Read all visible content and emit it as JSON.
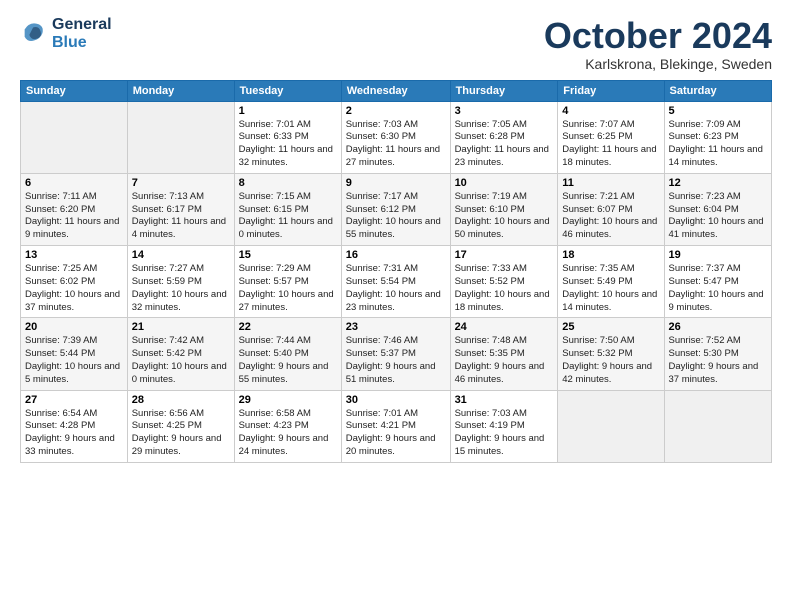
{
  "logo": {
    "line1": "General",
    "line2": "Blue"
  },
  "title": "October 2024",
  "subtitle": "Karlskrona, Blekinge, Sweden",
  "days_of_week": [
    "Sunday",
    "Monday",
    "Tuesday",
    "Wednesday",
    "Thursday",
    "Friday",
    "Saturday"
  ],
  "weeks": [
    {
      "row_class": "week-row-1",
      "days": [
        {
          "number": "",
          "info": "",
          "empty": true
        },
        {
          "number": "",
          "info": "",
          "empty": true
        },
        {
          "number": "1",
          "info": "Sunrise: 7:01 AM\nSunset: 6:33 PM\nDaylight: 11 hours\nand 32 minutes."
        },
        {
          "number": "2",
          "info": "Sunrise: 7:03 AM\nSunset: 6:30 PM\nDaylight: 11 hours\nand 27 minutes."
        },
        {
          "number": "3",
          "info": "Sunrise: 7:05 AM\nSunset: 6:28 PM\nDaylight: 11 hours\nand 23 minutes."
        },
        {
          "number": "4",
          "info": "Sunrise: 7:07 AM\nSunset: 6:25 PM\nDaylight: 11 hours\nand 18 minutes."
        },
        {
          "number": "5",
          "info": "Sunrise: 7:09 AM\nSunset: 6:23 PM\nDaylight: 11 hours\nand 14 minutes."
        }
      ]
    },
    {
      "row_class": "week-row-2",
      "days": [
        {
          "number": "6",
          "info": "Sunrise: 7:11 AM\nSunset: 6:20 PM\nDaylight: 11 hours\nand 9 minutes."
        },
        {
          "number": "7",
          "info": "Sunrise: 7:13 AM\nSunset: 6:17 PM\nDaylight: 11 hours\nand 4 minutes."
        },
        {
          "number": "8",
          "info": "Sunrise: 7:15 AM\nSunset: 6:15 PM\nDaylight: 11 hours\nand 0 minutes."
        },
        {
          "number": "9",
          "info": "Sunrise: 7:17 AM\nSunset: 6:12 PM\nDaylight: 10 hours\nand 55 minutes."
        },
        {
          "number": "10",
          "info": "Sunrise: 7:19 AM\nSunset: 6:10 PM\nDaylight: 10 hours\nand 50 minutes."
        },
        {
          "number": "11",
          "info": "Sunrise: 7:21 AM\nSunset: 6:07 PM\nDaylight: 10 hours\nand 46 minutes."
        },
        {
          "number": "12",
          "info": "Sunrise: 7:23 AM\nSunset: 6:04 PM\nDaylight: 10 hours\nand 41 minutes."
        }
      ]
    },
    {
      "row_class": "week-row-3",
      "days": [
        {
          "number": "13",
          "info": "Sunrise: 7:25 AM\nSunset: 6:02 PM\nDaylight: 10 hours\nand 37 minutes."
        },
        {
          "number": "14",
          "info": "Sunrise: 7:27 AM\nSunset: 5:59 PM\nDaylight: 10 hours\nand 32 minutes."
        },
        {
          "number": "15",
          "info": "Sunrise: 7:29 AM\nSunset: 5:57 PM\nDaylight: 10 hours\nand 27 minutes."
        },
        {
          "number": "16",
          "info": "Sunrise: 7:31 AM\nSunset: 5:54 PM\nDaylight: 10 hours\nand 23 minutes."
        },
        {
          "number": "17",
          "info": "Sunrise: 7:33 AM\nSunset: 5:52 PM\nDaylight: 10 hours\nand 18 minutes."
        },
        {
          "number": "18",
          "info": "Sunrise: 7:35 AM\nSunset: 5:49 PM\nDaylight: 10 hours\nand 14 minutes."
        },
        {
          "number": "19",
          "info": "Sunrise: 7:37 AM\nSunset: 5:47 PM\nDaylight: 10 hours\nand 9 minutes."
        }
      ]
    },
    {
      "row_class": "week-row-4",
      "days": [
        {
          "number": "20",
          "info": "Sunrise: 7:39 AM\nSunset: 5:44 PM\nDaylight: 10 hours\nand 5 minutes."
        },
        {
          "number": "21",
          "info": "Sunrise: 7:42 AM\nSunset: 5:42 PM\nDaylight: 10 hours\nand 0 minutes."
        },
        {
          "number": "22",
          "info": "Sunrise: 7:44 AM\nSunset: 5:40 PM\nDaylight: 9 hours\nand 55 minutes."
        },
        {
          "number": "23",
          "info": "Sunrise: 7:46 AM\nSunset: 5:37 PM\nDaylight: 9 hours\nand 51 minutes."
        },
        {
          "number": "24",
          "info": "Sunrise: 7:48 AM\nSunset: 5:35 PM\nDaylight: 9 hours\nand 46 minutes."
        },
        {
          "number": "25",
          "info": "Sunrise: 7:50 AM\nSunset: 5:32 PM\nDaylight: 9 hours\nand 42 minutes."
        },
        {
          "number": "26",
          "info": "Sunrise: 7:52 AM\nSunset: 5:30 PM\nDaylight: 9 hours\nand 37 minutes."
        }
      ]
    },
    {
      "row_class": "week-row-5",
      "days": [
        {
          "number": "27",
          "info": "Sunrise: 6:54 AM\nSunset: 4:28 PM\nDaylight: 9 hours\nand 33 minutes."
        },
        {
          "number": "28",
          "info": "Sunrise: 6:56 AM\nSunset: 4:25 PM\nDaylight: 9 hours\nand 29 minutes."
        },
        {
          "number": "29",
          "info": "Sunrise: 6:58 AM\nSunset: 4:23 PM\nDaylight: 9 hours\nand 24 minutes."
        },
        {
          "number": "30",
          "info": "Sunrise: 7:01 AM\nSunset: 4:21 PM\nDaylight: 9 hours\nand 20 minutes."
        },
        {
          "number": "31",
          "info": "Sunrise: 7:03 AM\nSunset: 4:19 PM\nDaylight: 9 hours\nand 15 minutes."
        },
        {
          "number": "",
          "info": "",
          "empty": true
        },
        {
          "number": "",
          "info": "",
          "empty": true
        }
      ]
    }
  ]
}
